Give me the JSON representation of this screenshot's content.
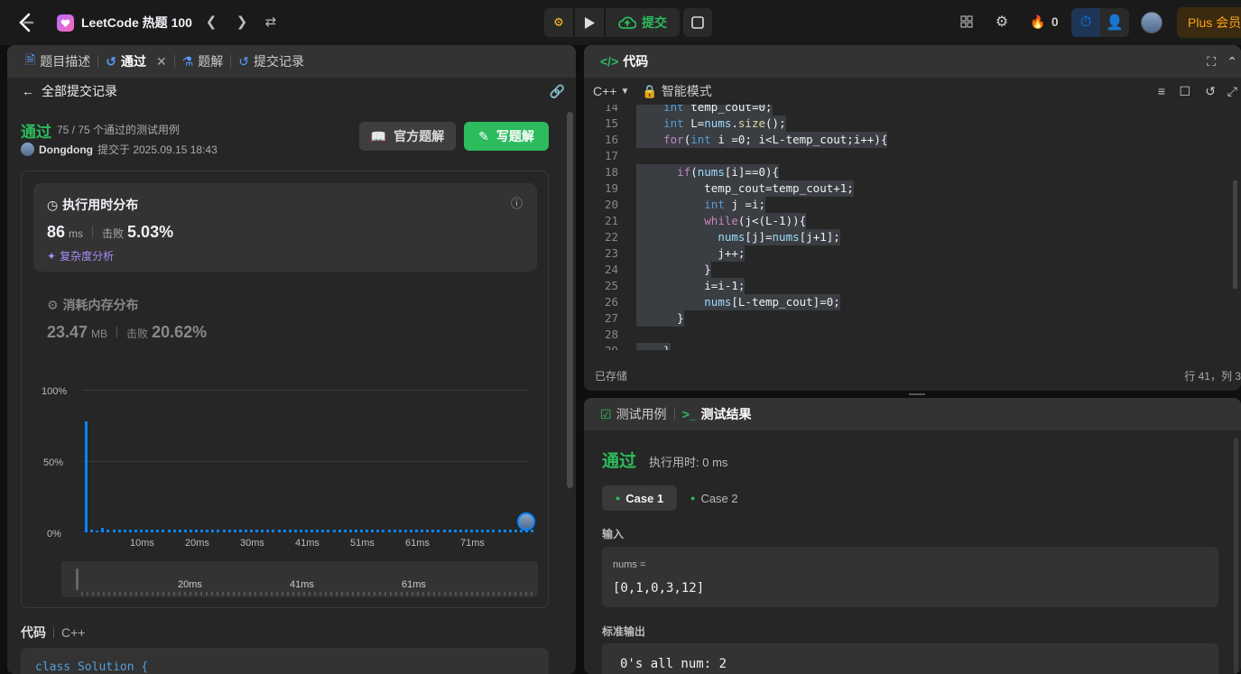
{
  "topbar": {
    "list_title": "LeetCode 热题 100",
    "submit_label": "提交",
    "points": "0",
    "plus_label": "Plus 会员"
  },
  "left_panel": {
    "tabs": [
      {
        "label": "题目描述"
      },
      {
        "label": "通过"
      },
      {
        "label": "题解"
      },
      {
        "label": "提交记录"
      }
    ],
    "back_label": "全部提交记录",
    "status": "通过",
    "testcases_summary": "75 / 75 个通过的测试用例",
    "user": "Dongdong",
    "submitted_at": "提交于 2025.09.15 18:43",
    "official_solution_btn": "官方题解",
    "write_solution_btn": "写题解",
    "runtime": {
      "title": "执行用时分布",
      "value": "86",
      "unit": "ms",
      "beats_label": "击败",
      "beats": "5.03%",
      "complexity_link": "复杂度分析"
    },
    "memory": {
      "title": "消耗内存分布",
      "value": "23.47",
      "unit": "MB",
      "beats_label": "击败",
      "beats": "20.62%"
    },
    "code_label": "代码",
    "code_lang": "C++",
    "code_first_line": "class Solution {"
  },
  "chart_data": {
    "type": "bar",
    "y_tick_labels": [
      "100%",
      "50%",
      "0%"
    ],
    "x_tick_labels": [
      "10ms",
      "20ms",
      "30ms",
      "41ms",
      "51ms",
      "61ms",
      "71ms"
    ],
    "minimap_tick_labels": [
      "20ms",
      "41ms",
      "61ms"
    ],
    "ylim": [
      0,
      100
    ],
    "grid": true,
    "values": [
      78,
      2,
      1.5,
      3,
      2,
      2,
      2,
      2,
      2,
      2,
      2,
      2,
      2,
      2,
      2,
      2,
      2,
      2,
      2,
      2,
      2,
      2,
      2,
      2,
      2,
      2,
      2,
      2,
      2,
      2,
      2,
      2,
      2,
      2,
      2,
      2,
      2,
      2,
      2,
      2,
      2,
      2,
      2,
      2,
      2,
      2,
      2,
      2,
      2,
      2,
      2,
      2,
      2,
      2,
      2,
      2,
      2,
      2,
      2,
      2,
      2,
      2,
      2,
      2,
      2,
      2,
      2,
      2,
      2,
      2,
      2,
      2,
      2,
      2,
      2,
      2,
      2,
      2,
      2,
      2,
      2,
      2
    ],
    "highlight_index": 80
  },
  "code_panel": {
    "title": "代码",
    "lang": "C++",
    "mode": "智能模式",
    "saved": "已存储",
    "cursor": "行 41，列 3",
    "lines": [
      {
        "n": "14",
        "t": "    int temp_cout=0;"
      },
      {
        "n": "15",
        "t": "    int L=nums.size();"
      },
      {
        "n": "16",
        "t": "    for(int i =0; i<L-temp_cout;i++){"
      },
      {
        "n": "17",
        "t": ""
      },
      {
        "n": "18",
        "t": "      if(nums[i]==0){"
      },
      {
        "n": "19",
        "t": "          temp_cout=temp_cout+1;"
      },
      {
        "n": "20",
        "t": "          int j =i;"
      },
      {
        "n": "21",
        "t": "          while(j<(L-1)){"
      },
      {
        "n": "22",
        "t": "            nums[j]=nums[j+1];"
      },
      {
        "n": "23",
        "t": "            j++;"
      },
      {
        "n": "24",
        "t": "          }"
      },
      {
        "n": "25",
        "t": "          i=i-1;"
      },
      {
        "n": "26",
        "t": "          nums[L-temp_cout]=0;"
      },
      {
        "n": "27",
        "t": "      }"
      },
      {
        "n": "28",
        "t": ""
      },
      {
        "n": "29",
        "t": "    }"
      }
    ]
  },
  "test_panel": {
    "tab_cases": "测试用例",
    "tab_results": "测试结果",
    "status": "通过",
    "runtime_label": "执行用时: 0 ms",
    "case1": "Case 1",
    "case2": "Case 2",
    "input_label": "输入",
    "input_var": "nums =",
    "input_value": "[0,1,0,3,12]",
    "stdout_label": "标准输出",
    "stdout_value": "0's all num: 2"
  },
  "colors": {
    "accent_green": "#2cbb5d",
    "accent_blue": "#0a84ff",
    "brand_orange": "#ffa116"
  }
}
